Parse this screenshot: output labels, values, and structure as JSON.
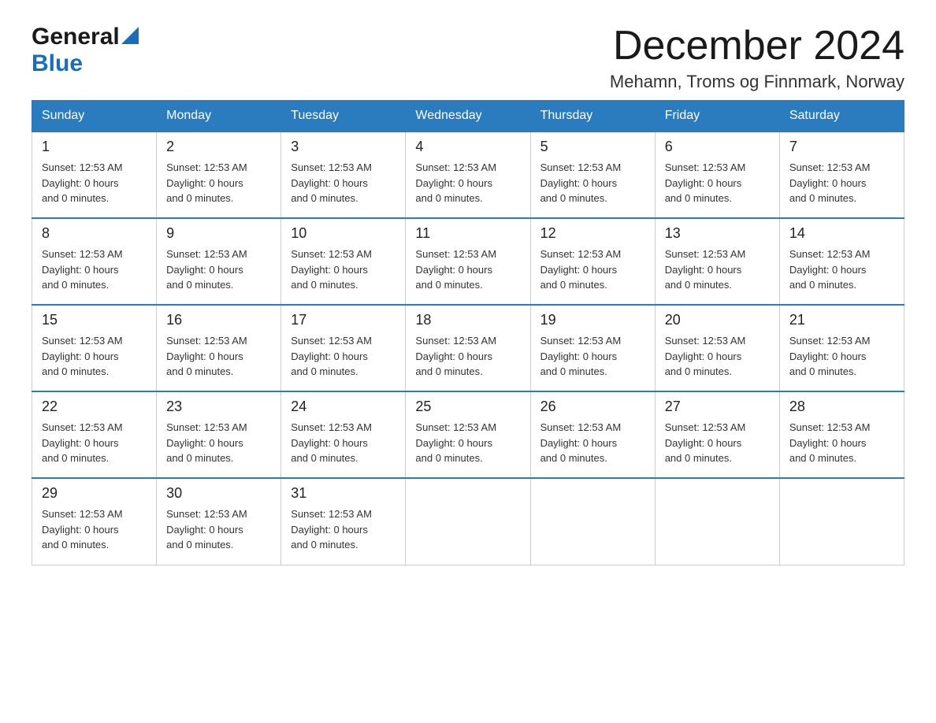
{
  "logo": {
    "general": "General",
    "blue": "Blue"
  },
  "header": {
    "month_year": "December 2024",
    "location": "Mehamn, Troms og Finnmark, Norway"
  },
  "days_of_week": [
    "Sunday",
    "Monday",
    "Tuesday",
    "Wednesday",
    "Thursday",
    "Friday",
    "Saturday"
  ],
  "accent_color": "#2b7bbf",
  "cell_info": "Sunset: 12:53 AM\nDaylight: 0 hours\nand 0 minutes.",
  "weeks": [
    {
      "days": [
        {
          "num": "1",
          "info": "Sunset: 12:53 AM\nDaylight: 0 hours\nand 0 minutes."
        },
        {
          "num": "2",
          "info": "Sunset: 12:53 AM\nDaylight: 0 hours\nand 0 minutes."
        },
        {
          "num": "3",
          "info": "Sunset: 12:53 AM\nDaylight: 0 hours\nand 0 minutes."
        },
        {
          "num": "4",
          "info": "Sunset: 12:53 AM\nDaylight: 0 hours\nand 0 minutes."
        },
        {
          "num": "5",
          "info": "Sunset: 12:53 AM\nDaylight: 0 hours\nand 0 minutes."
        },
        {
          "num": "6",
          "info": "Sunset: 12:53 AM\nDaylight: 0 hours\nand 0 minutes."
        },
        {
          "num": "7",
          "info": "Sunset: 12:53 AM\nDaylight: 0 hours\nand 0 minutes."
        }
      ]
    },
    {
      "days": [
        {
          "num": "8",
          "info": "Sunset: 12:53 AM\nDaylight: 0 hours\nand 0 minutes."
        },
        {
          "num": "9",
          "info": "Sunset: 12:53 AM\nDaylight: 0 hours\nand 0 minutes."
        },
        {
          "num": "10",
          "info": "Sunset: 12:53 AM\nDaylight: 0 hours\nand 0 minutes."
        },
        {
          "num": "11",
          "info": "Sunset: 12:53 AM\nDaylight: 0 hours\nand 0 minutes."
        },
        {
          "num": "12",
          "info": "Sunset: 12:53 AM\nDaylight: 0 hours\nand 0 minutes."
        },
        {
          "num": "13",
          "info": "Sunset: 12:53 AM\nDaylight: 0 hours\nand 0 minutes."
        },
        {
          "num": "14",
          "info": "Sunset: 12:53 AM\nDaylight: 0 hours\nand 0 minutes."
        }
      ]
    },
    {
      "days": [
        {
          "num": "15",
          "info": "Sunset: 12:53 AM\nDaylight: 0 hours\nand 0 minutes."
        },
        {
          "num": "16",
          "info": "Sunset: 12:53 AM\nDaylight: 0 hours\nand 0 minutes."
        },
        {
          "num": "17",
          "info": "Sunset: 12:53 AM\nDaylight: 0 hours\nand 0 minutes."
        },
        {
          "num": "18",
          "info": "Sunset: 12:53 AM\nDaylight: 0 hours\nand 0 minutes."
        },
        {
          "num": "19",
          "info": "Sunset: 12:53 AM\nDaylight: 0 hours\nand 0 minutes."
        },
        {
          "num": "20",
          "info": "Sunset: 12:53 AM\nDaylight: 0 hours\nand 0 minutes."
        },
        {
          "num": "21",
          "info": "Sunset: 12:53 AM\nDaylight: 0 hours\nand 0 minutes."
        }
      ]
    },
    {
      "days": [
        {
          "num": "22",
          "info": "Sunset: 12:53 AM\nDaylight: 0 hours\nand 0 minutes."
        },
        {
          "num": "23",
          "info": "Sunset: 12:53 AM\nDaylight: 0 hours\nand 0 minutes."
        },
        {
          "num": "24",
          "info": "Sunset: 12:53 AM\nDaylight: 0 hours\nand 0 minutes."
        },
        {
          "num": "25",
          "info": "Sunset: 12:53 AM\nDaylight: 0 hours\nand 0 minutes."
        },
        {
          "num": "26",
          "info": "Sunset: 12:53 AM\nDaylight: 0 hours\nand 0 minutes."
        },
        {
          "num": "27",
          "info": "Sunset: 12:53 AM\nDaylight: 0 hours\nand 0 minutes."
        },
        {
          "num": "28",
          "info": "Sunset: 12:53 AM\nDaylight: 0 hours\nand 0 minutes."
        }
      ]
    },
    {
      "days": [
        {
          "num": "29",
          "info": "Sunset: 12:53 AM\nDaylight: 0 hours\nand 0 minutes."
        },
        {
          "num": "30",
          "info": "Sunset: 12:53 AM\nDaylight: 0 hours\nand 0 minutes."
        },
        {
          "num": "31",
          "info": "Sunset: 12:53 AM\nDaylight: 0 hours\nand 0 minutes."
        },
        {
          "num": "",
          "info": ""
        },
        {
          "num": "",
          "info": ""
        },
        {
          "num": "",
          "info": ""
        },
        {
          "num": "",
          "info": ""
        }
      ]
    }
  ]
}
